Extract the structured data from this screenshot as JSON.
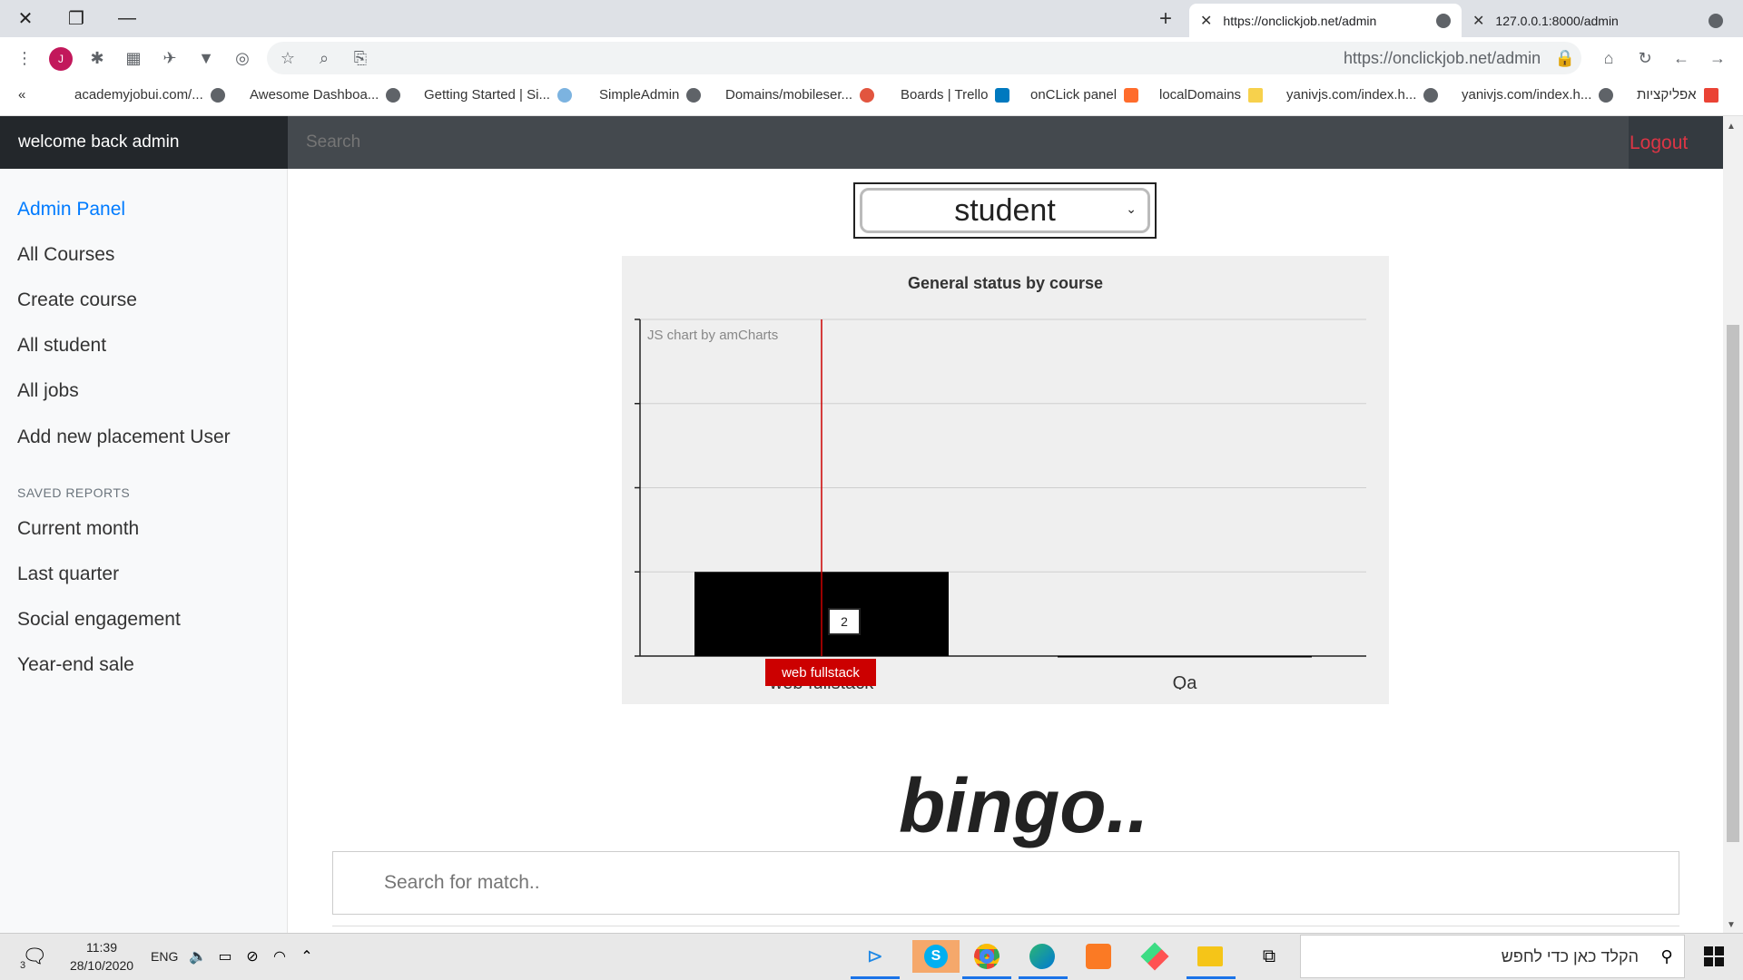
{
  "browser": {
    "tabs": [
      {
        "title": "https://onclickjob.net/admin",
        "active": true
      },
      {
        "title": "127.0.0.1:8000/admin",
        "active": false
      }
    ],
    "url": "https://onclickjob.net/admin",
    "profile_initial": "J",
    "bookmarks": [
      "academyjobui.com/...",
      "Awesome Dashboa...",
      "Getting Started | Si...",
      "SimpleAdmin",
      "Domains/mobileser...",
      "Boards | Trello",
      "onCLick panel",
      "localDomains",
      "yanivjs.com/index.h...",
      "yanivjs.com/index.h...",
      "אפליקציות"
    ]
  },
  "navbar": {
    "brand": "welcome back admin",
    "search_placeholder": "Search",
    "logout_label": "Logout"
  },
  "sidebar": {
    "items": [
      {
        "label": "Admin Panel",
        "active": true
      },
      {
        "label": "All Courses"
      },
      {
        "label": "Create course"
      },
      {
        "label": "All student"
      },
      {
        "label": "All jobs"
      },
      {
        "label": "Add new placement User"
      }
    ],
    "saved_reports_heading": "SAVED REPORTS",
    "reports": [
      {
        "label": "Current month"
      },
      {
        "label": "Last quarter"
      },
      {
        "label": "Social engagement"
      },
      {
        "label": "Year-end sale"
      }
    ]
  },
  "main": {
    "select_value": "student",
    "bingo_title": "bingo..",
    "match_search_placeholder": "Search for match.."
  },
  "chart_data": {
    "type": "bar",
    "title": "General status by course",
    "credit": "JS chart by amCharts",
    "categories": [
      "web fullstack",
      "Qa"
    ],
    "values": [
      2,
      0
    ],
    "cursor_category": "web fullstack",
    "tooltip_value": "2",
    "grid": true,
    "ylim": [
      0,
      8
    ],
    "bar_color": "#000000",
    "cursor_color": "#cc0000"
  },
  "taskbar": {
    "time": "11:39",
    "date": "28/10/2020",
    "lang": "ENG",
    "notification_count": "3",
    "search_placeholder": "הקלד כאן כדי לחפש"
  }
}
